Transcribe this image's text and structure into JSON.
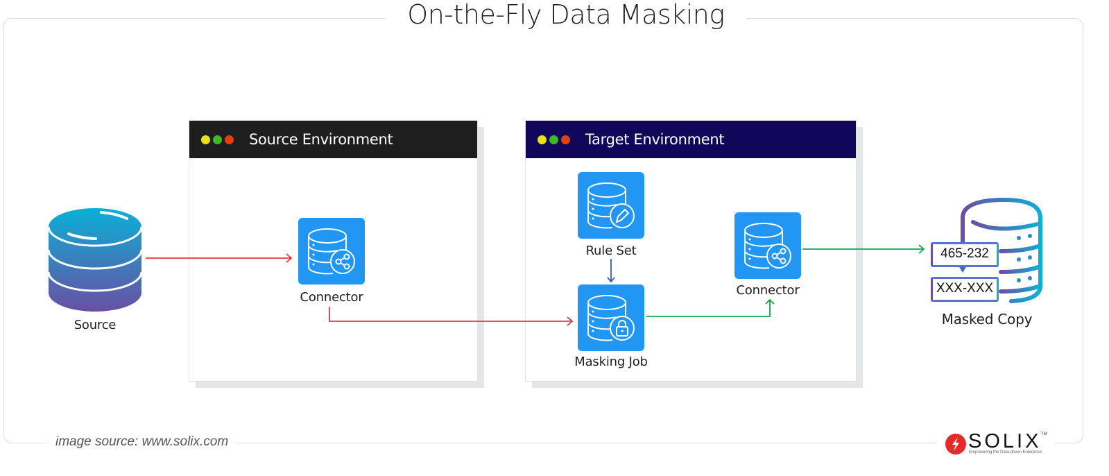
{
  "title": "On-the-Fly Data Masking",
  "source": {
    "label": "Source"
  },
  "source_environment": {
    "title": "Source Environment",
    "header_color": "#1f1e1e",
    "dots": [
      "#e8e114",
      "#3db72f",
      "#e0420f"
    ],
    "connector": {
      "label": "Connector",
      "icon": "database-share-icon"
    }
  },
  "target_environment": {
    "title": "Target Environment",
    "header_color": "#11065a",
    "dots": [
      "#e8e114",
      "#3db72f",
      "#e0420f"
    ],
    "rule_set": {
      "label": "Rule Set",
      "icon": "database-edit-icon"
    },
    "masking_job": {
      "label": "Masking Job",
      "icon": "database-lock-icon"
    },
    "connector": {
      "label": "Connector",
      "icon": "database-share-icon"
    }
  },
  "masked_copy": {
    "label": "Masked Copy",
    "original_value": "465-232",
    "masked_value": "XXX-XXX"
  },
  "colors": {
    "node_blue": "#2196f3",
    "flow_red": "#e8343e",
    "flow_green": "#13a84a",
    "flow_blue": "#3c5aa8"
  },
  "footer": {
    "image_source": "image source: www.solix.com",
    "logo_text": "SOLIX",
    "logo_tm": "TM",
    "logo_tagline": "Empowering the Data-driven Enterprise"
  }
}
